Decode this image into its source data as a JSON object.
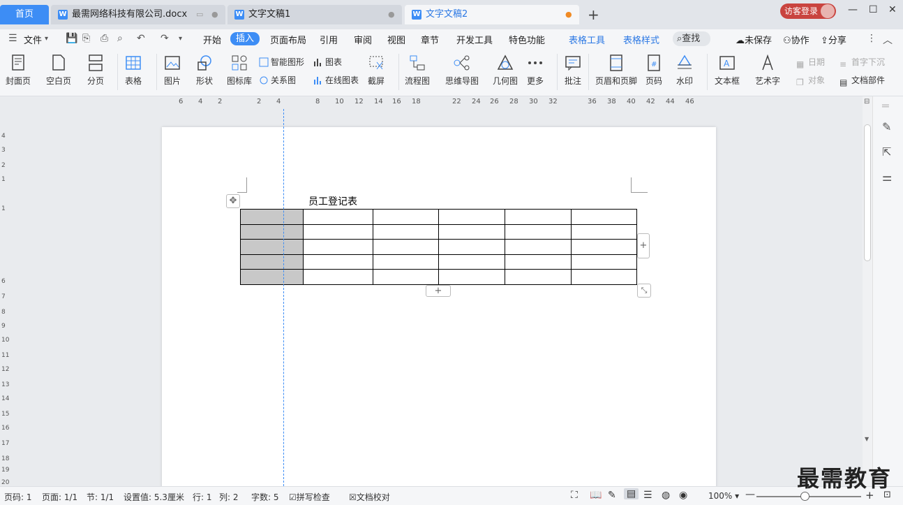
{
  "tabs": {
    "home": "首页",
    "items": [
      {
        "title": "最需网络科技有限公司.docx"
      },
      {
        "title": "文字文稿1"
      },
      {
        "title": "文字文稿2"
      }
    ],
    "new_tab": "+"
  },
  "account": {
    "login": "访客登录"
  },
  "menu": {
    "file": "文件",
    "items": [
      "开始",
      "插入",
      "页面布局",
      "引用",
      "审阅",
      "视图",
      "章节",
      "开发工具",
      "特色功能"
    ],
    "active": "插入",
    "context": [
      "表格工具",
      "表格样式"
    ],
    "search": "查找",
    "unsaved": "未保存",
    "collab": "协作",
    "share": "分享"
  },
  "ribbon": {
    "big": [
      {
        "label": "封面页"
      },
      {
        "label": "空白页"
      },
      {
        "label": "分页"
      },
      {
        "label": "表格"
      },
      {
        "label": "图片"
      },
      {
        "label": "形状"
      },
      {
        "label": "图标库"
      },
      {
        "label": "截屏"
      },
      {
        "label": "流程图"
      },
      {
        "label": "思维导图"
      },
      {
        "label": "几何图"
      },
      {
        "label": "更多"
      },
      {
        "label": "批注"
      },
      {
        "label": "页眉和页脚"
      },
      {
        "label": "页码"
      },
      {
        "label": "水印"
      },
      {
        "label": "文本框"
      },
      {
        "label": "艺术字"
      }
    ],
    "small": {
      "smart_shape": "智能图形",
      "chart": "图表",
      "relation": "关系图",
      "online_chart": "在线图表",
      "date": "日期",
      "dropcap": "首字下沉",
      "object": "对象",
      "doc_parts": "文档部件"
    }
  },
  "ruler": {
    "h": [
      "6",
      "4",
      "2",
      "2",
      "4",
      "8",
      "10",
      "12",
      "14",
      "16",
      "18",
      "22",
      "24",
      "26",
      "28",
      "30",
      "32",
      "36",
      "38",
      "40",
      "42",
      "44",
      "46"
    ],
    "v": [
      "4",
      "3",
      "2",
      "1",
      "1",
      "6",
      "7",
      "8",
      "9",
      "10",
      "11",
      "12",
      "13",
      "14",
      "15",
      "16",
      "17",
      "18",
      "19",
      "20"
    ]
  },
  "document": {
    "title": "员工登记表",
    "rows": 5,
    "cols": 6
  },
  "status": {
    "page": "页码: 1",
    "pages": "页面: 1/1",
    "section": "节: 1/1",
    "setting": "设置值: 5.3厘米",
    "row": "行: 1",
    "col": "列: 2",
    "words": "字数: 5",
    "spell": "拼写检查",
    "proof": "文档校对",
    "zoom": "100%"
  },
  "zoom_level": 0.46,
  "watermark": "最需教育"
}
